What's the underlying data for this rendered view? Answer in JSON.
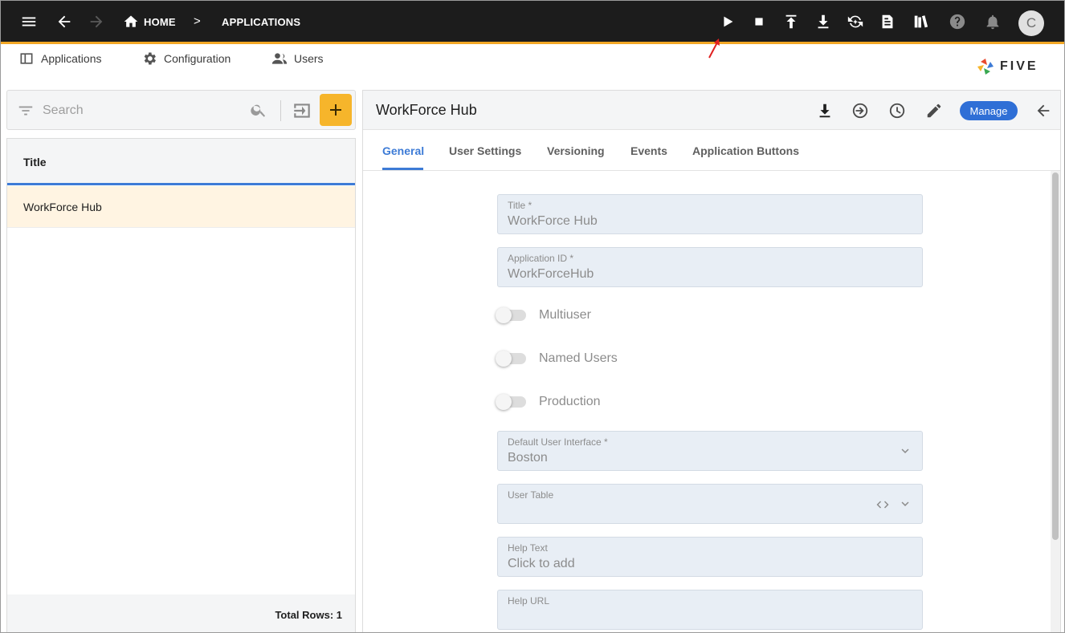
{
  "topbar": {
    "breadcrumb_home": "HOME",
    "breadcrumb_current": "APPLICATIONS",
    "crumb_separator": ">",
    "avatar_initial": "C",
    "accent_color": "#f2a725"
  },
  "menu": {
    "applications": "Applications",
    "configuration": "Configuration",
    "users": "Users"
  },
  "logo_text": "FIVE",
  "left_panel": {
    "search_placeholder": "Search",
    "column_title": "Title",
    "rows": [
      "WorkForce Hub"
    ],
    "total_rows_label": "Total Rows: 1"
  },
  "detail": {
    "title": "WorkForce Hub",
    "manage_label": "Manage",
    "tabs": [
      "General",
      "User Settings",
      "Versioning",
      "Events",
      "Application Buttons"
    ],
    "active_tab": "General",
    "fields": {
      "title_label": "Title *",
      "title_value": "WorkForce Hub",
      "app_id_label": "Application ID *",
      "app_id_value": "WorkForceHub",
      "multiuser_label": "Multiuser",
      "named_users_label": "Named Users",
      "production_label": "Production",
      "default_ui_label": "Default User Interface *",
      "default_ui_value": "Boston",
      "user_table_label": "User Table",
      "user_table_value": "",
      "help_text_label": "Help Text",
      "help_text_value": "Click to add",
      "help_url_label": "Help URL",
      "help_url_value": ""
    },
    "toggles": {
      "multiuser": false,
      "named_users": false,
      "production": false
    }
  },
  "colors": {
    "primary": "#3d7bd6",
    "add_button": "#f6b52b",
    "selected_row": "#fff4e2",
    "annotation_arrow": "#e02020"
  }
}
